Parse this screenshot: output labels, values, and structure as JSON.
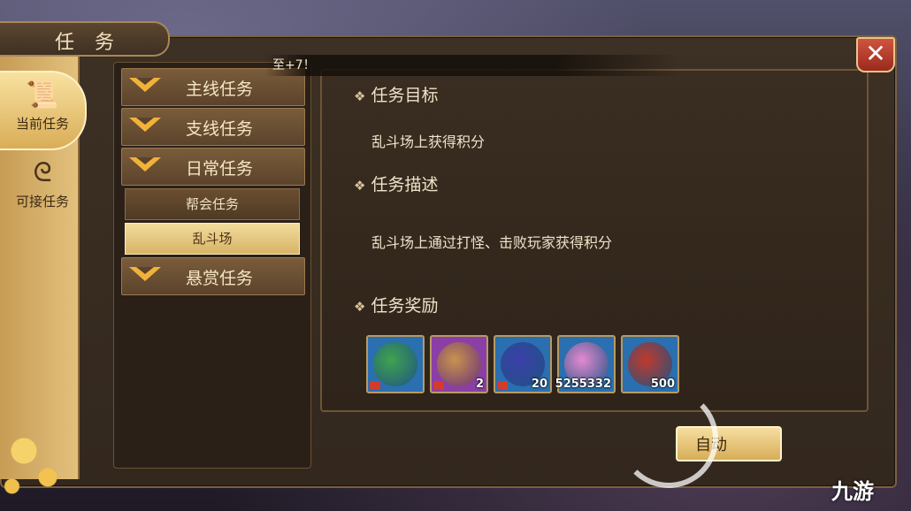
{
  "window": {
    "title": "任 务",
    "close_symbol": "✕"
  },
  "notice": "至+7！",
  "rail": [
    {
      "label": "当前任务",
      "icon": "scroll-icon",
      "glyph": "📜"
    },
    {
      "label": "可接任务",
      "icon": "swirl-icon",
      "glyph": "ᘓ"
    }
  ],
  "categories": [
    {
      "label": "主线任务"
    },
    {
      "label": "支线任务"
    },
    {
      "label": "日常任务"
    },
    {
      "label": "悬赏任务"
    }
  ],
  "subs": [
    {
      "label": "帮会任务"
    },
    {
      "label": "乱斗场"
    }
  ],
  "detail": {
    "goal_title": "任务目标",
    "goal_text": "乱斗场上获得积分",
    "desc_title": "任务描述",
    "desc_text": "乱斗场上通过打怪、击败玩家获得积分",
    "reward_title": "任务奖励",
    "rewards": [
      {
        "name": "jade-bag-icon",
        "count": "",
        "locked": true,
        "bg": "#2a6fb0"
      },
      {
        "name": "scarecrow-icon",
        "count": "2",
        "locked": true,
        "bg": "#8b3fa6"
      },
      {
        "name": "gourd-icon",
        "count": "20",
        "locked": true,
        "bg": "#2a6fb0"
      },
      {
        "name": "scroll-icon",
        "count": "5255332",
        "locked": false,
        "bg": "#2a6fb0"
      },
      {
        "name": "red-envelope-icon",
        "count": "500",
        "locked": false,
        "bg": "#2a6fb0"
      }
    ]
  },
  "auto_button": "自动",
  "watermark": "九游"
}
